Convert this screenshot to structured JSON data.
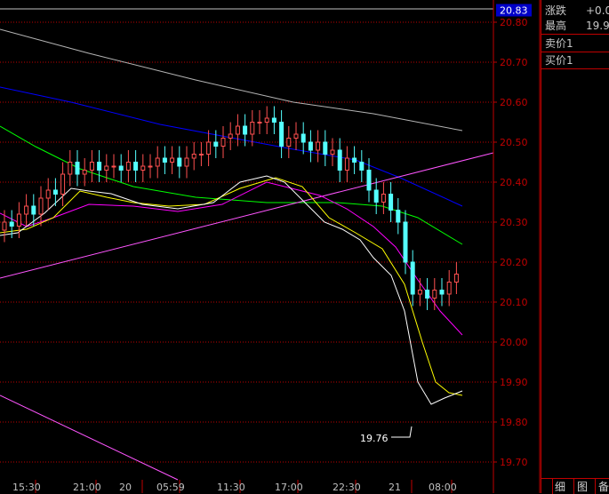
{
  "chart_data": {
    "type": "candlestick",
    "y_axis": {
      "min": 19.65,
      "max": 20.85,
      "ticks": [
        "19.70",
        "19.80",
        "19.90",
        "20.00",
        "20.10",
        "20.20",
        "20.30",
        "20.40",
        "20.50",
        "20.60",
        "20.70",
        "20.80"
      ],
      "current_price": "20.83"
    },
    "x_axis_labels": [
      "15:30",
      "21:00",
      "20",
      "05:59",
      "11:30",
      "17:00",
      "22:30",
      "21",
      "08:00"
    ],
    "low_marker": "19.76",
    "colors": {
      "up": "#ff5050",
      "down": "#54ffff",
      "ma5": "#ffffff",
      "ma10": "#ffff00",
      "ma20": "#ff00ff",
      "ma60": "#00ff00",
      "ma120": "#0000ff",
      "ma250": "#b4b4b4",
      "trendline": "#ff55ff",
      "grid": "#c00000",
      "axis_text": "#c00000"
    }
  },
  "panel": {
    "rows": [
      {
        "label": "涨跌",
        "value": "+0.0"
      },
      {
        "label": "最高",
        "value": "19.9"
      },
      {
        "label": "卖价1",
        "value": ""
      },
      {
        "label": "买价1",
        "value": ""
      }
    ],
    "tabs": [
      "细",
      "图",
      "备"
    ]
  }
}
